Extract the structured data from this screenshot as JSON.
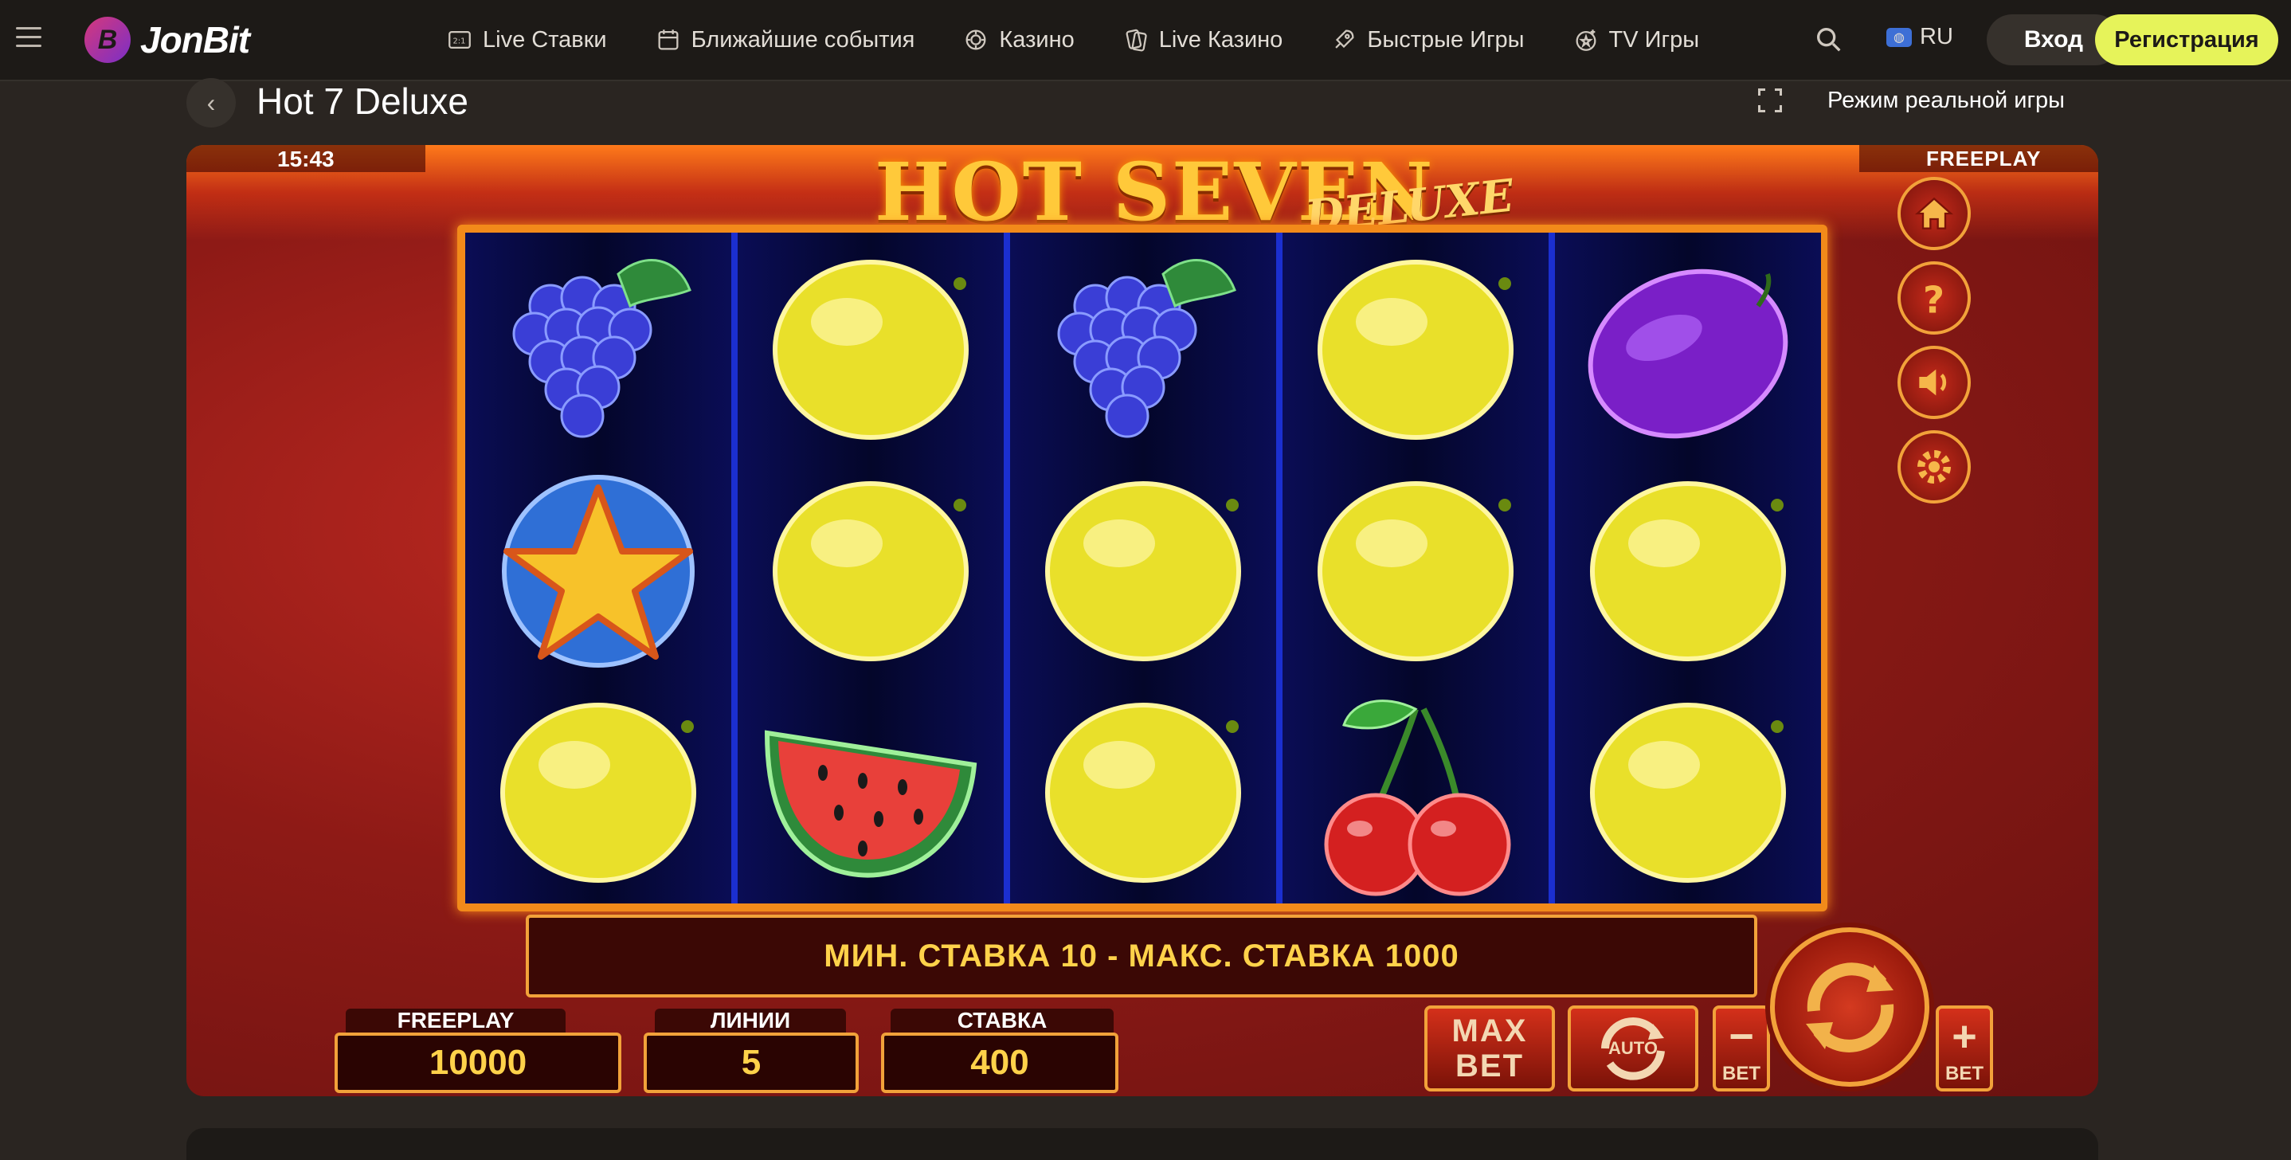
{
  "brand": {
    "name": "JonBit",
    "mark": "B"
  },
  "nav": [
    {
      "label": "Live Ставки",
      "icon": "live-scoreboard-icon"
    },
    {
      "label": "Ближайшие события",
      "icon": "calendar-icon"
    },
    {
      "label": "Казино",
      "icon": "casino-chip-icon"
    },
    {
      "label": "Live Казино",
      "icon": "cards-icon"
    },
    {
      "label": "Быстрые Игры",
      "icon": "rocket-icon"
    },
    {
      "label": "TV Игры",
      "icon": "tv-games-icon"
    }
  ],
  "header": {
    "lang": "RU",
    "login_label": "Вход",
    "register_label": "Регистрация"
  },
  "page": {
    "title": "Hot 7 Deluxe",
    "real_mode_label": "Режим реальной игры"
  },
  "game": {
    "clock": "15:43",
    "mode": "FREEPLAY",
    "logo_main": "HOT SEVEN",
    "logo_sub": "DELUXE",
    "reels": [
      [
        "grapes",
        "star",
        "lemon"
      ],
      [
        "lemon",
        "lemon",
        "watermelon"
      ],
      [
        "grapes",
        "lemon",
        "lemon"
      ],
      [
        "lemon",
        "lemon",
        "cherry"
      ],
      [
        "plum",
        "lemon",
        "lemon"
      ]
    ],
    "message": "МИН. СТАВКА 10 - МАКС. СТАВКА 1000",
    "stats": {
      "balance_label": "FREEPLAY",
      "balance_value": "10000",
      "lines_label": "ЛИНИИ",
      "lines_value": "5",
      "bet_label": "СТАВКА",
      "bet_value": "400"
    },
    "buttons": {
      "max_line1": "MAX",
      "max_line2": "BET",
      "auto": "AUTO",
      "minus_sign": "−",
      "plus_sign": "+",
      "bet": "BET"
    },
    "side_buttons": [
      "home-icon",
      "help-icon",
      "sound-icon",
      "settings-icon"
    ]
  },
  "colors": {
    "accent": "#e6f35a",
    "frame": "#f2a23a",
    "gold_text": "#ffd24a",
    "reel_bg": "#060a3a",
    "page_bg": "#2a2521"
  }
}
